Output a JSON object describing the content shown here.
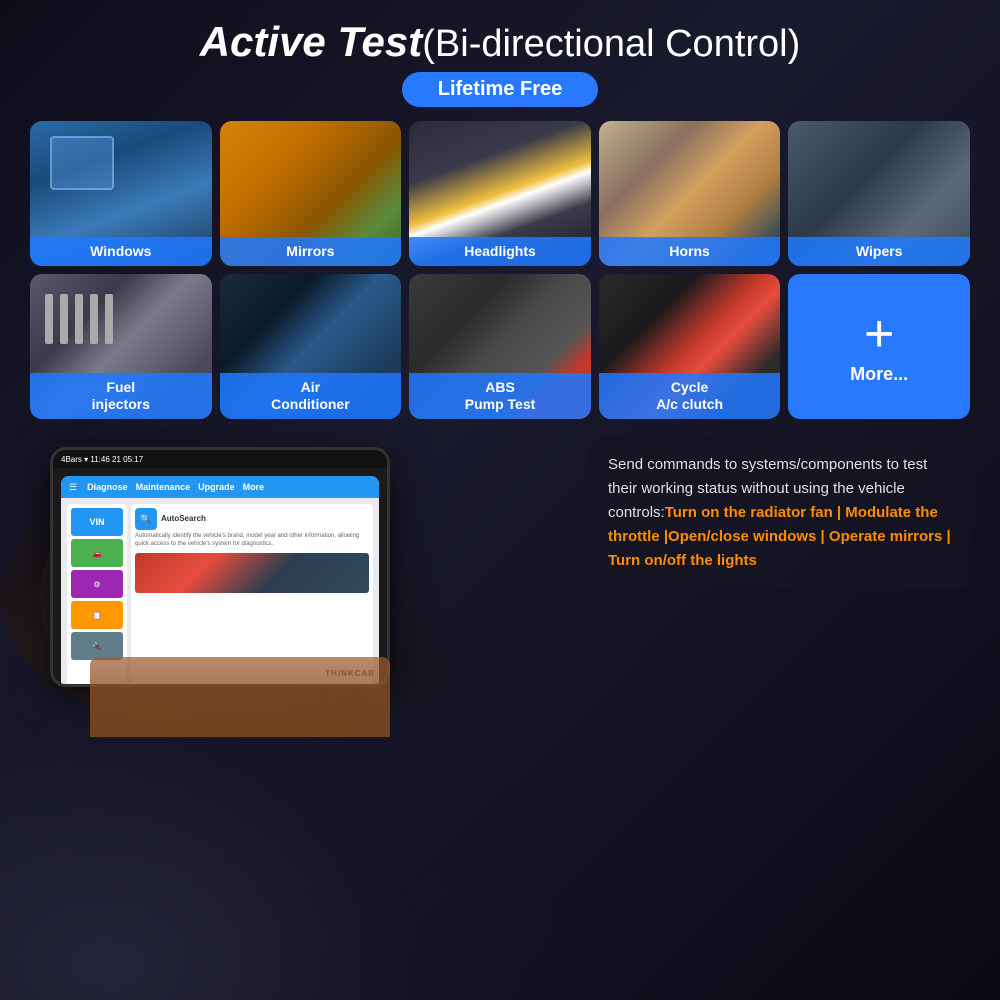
{
  "page": {
    "title_bold": "Active Test",
    "title_normal": "(Bi-directional Control)",
    "badge": "Lifetime Free"
  },
  "row1": [
    {
      "id": "windows",
      "label": "Windows",
      "img_class": "img-windows"
    },
    {
      "id": "mirrors",
      "label": "Mirrors",
      "img_class": "img-mirrors"
    },
    {
      "id": "headlights",
      "label": "Headlights",
      "img_class": "img-headlights"
    },
    {
      "id": "horns",
      "label": "Horns",
      "img_class": "img-horns"
    },
    {
      "id": "wipers",
      "label": "Wipers",
      "img_class": "img-wipers"
    }
  ],
  "row2": [
    {
      "id": "fuel",
      "label": "Fuel\ninjectors",
      "img_class": "img-fuel"
    },
    {
      "id": "ac",
      "label": "Air\nConditioner",
      "img_class": "img-ac"
    },
    {
      "id": "abs",
      "label": "ABS\nPump Test",
      "img_class": "img-abs"
    },
    {
      "id": "cycle",
      "label": "Cycle\nA/c clutch",
      "img_class": "img-cycle"
    }
  ],
  "more": {
    "plus": "+",
    "label": "More..."
  },
  "tablet": {
    "nav": [
      "Diagnose",
      "Maintenance",
      "Upgrade",
      "More"
    ],
    "sidebar_items": [
      "VIN",
      "🚗",
      "⚙",
      "📋",
      "🔌"
    ],
    "autosearch_label": "AutoSearch",
    "autosearch_desc": "Automatically identify the vehicle's brand, model year and other information, allowing quick access to the vehicle's system for diagnostics.",
    "brand": "THINKCAR"
  },
  "description": {
    "normal_text": "Send commands to systems/components to test their working status without using the vehicle controls:",
    "orange_text": "Turn on the radiator fan | Modulate the throttle |Open/close windows | Operate mirrors | Turn on/off the lights"
  },
  "colors": {
    "accent_blue": "#2979ff",
    "accent_orange": "#ff8c00",
    "bg_dark": "#1a1a2e"
  }
}
